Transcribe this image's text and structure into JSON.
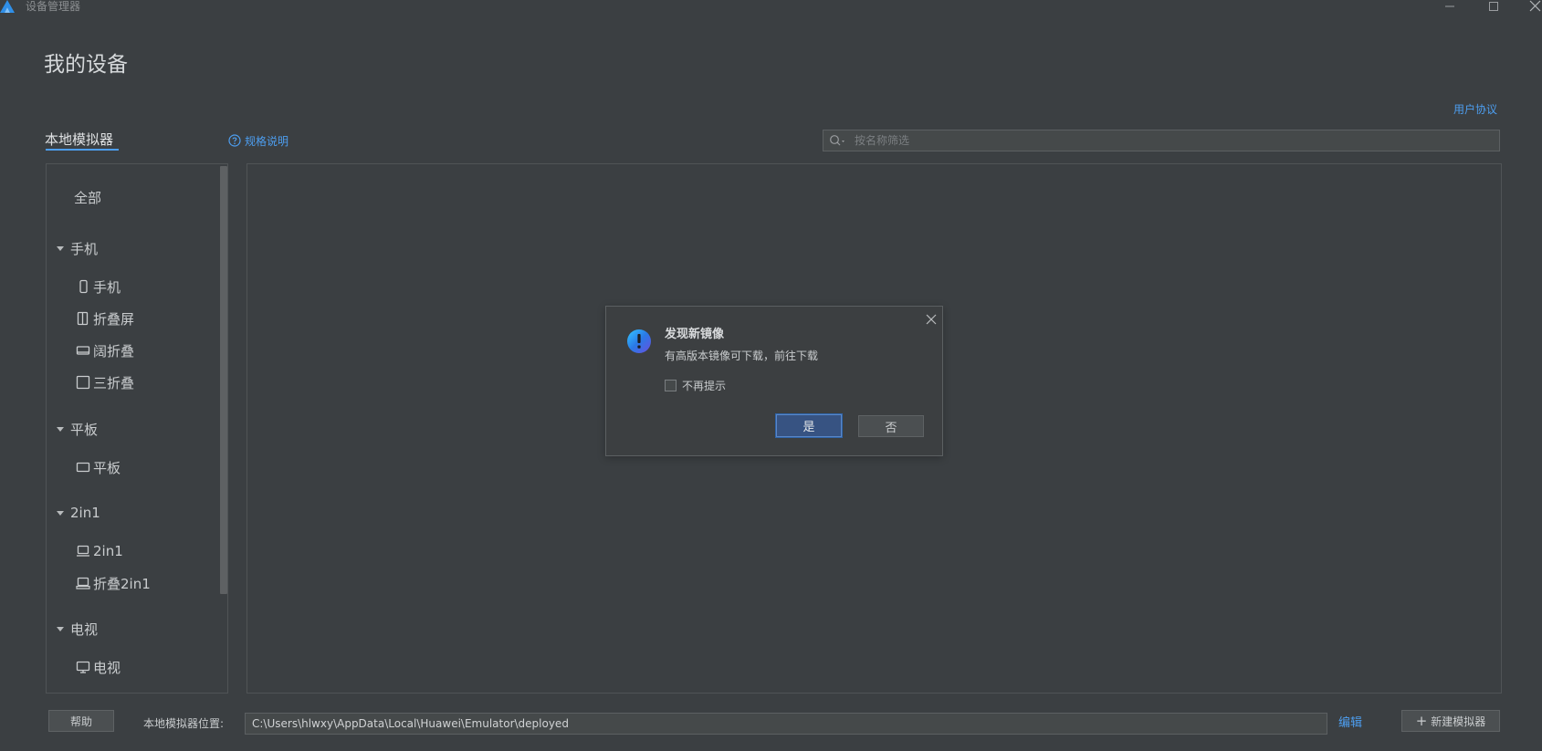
{
  "window": {
    "title": "设备管理器",
    "logo_icon": "harmony-logo-icon",
    "controls": [
      "minimize-icon",
      "maximize-icon",
      "close-icon"
    ]
  },
  "page": {
    "title": "我的设备",
    "agreement_link": "用户协议"
  },
  "tabs": {
    "local_emulator": "本地模拟器",
    "spec_link": "规格说明"
  },
  "search": {
    "placeholder": "按名称筛选",
    "icon": "search-icon"
  },
  "sidebar": {
    "all": "全部",
    "groups": [
      {
        "label": "手机",
        "items": [
          {
            "label": "手机",
            "icon": "phone-icon"
          },
          {
            "label": "折叠屏",
            "icon": "foldable-icon"
          },
          {
            "label": "阔折叠",
            "icon": "wide-fold-icon"
          },
          {
            "label": "三折叠",
            "icon": "tri-fold-icon"
          }
        ]
      },
      {
        "label": "平板",
        "items": [
          {
            "label": "平板",
            "icon": "tablet-icon"
          }
        ]
      },
      {
        "label": "2in1",
        "items": [
          {
            "label": "2in1",
            "icon": "laptop-icon"
          },
          {
            "label": "折叠2in1",
            "icon": "fold-laptop-icon"
          }
        ]
      },
      {
        "label": "电视",
        "items": [
          {
            "label": "电视",
            "icon": "tv-icon"
          }
        ]
      }
    ]
  },
  "bottom": {
    "help_button": "帮助",
    "location_label": "本地模拟器位置:",
    "location_value": "C:\\Users\\hlwxy\\AppData\\Local\\Huawei\\Emulator\\deployed",
    "edit_link": "编辑",
    "new_emulator_button": "新建模拟器"
  },
  "dialog": {
    "title": "发现新镜像",
    "message": "有高版本镜像可下载，前往下载",
    "checkbox_label": "不再提示",
    "yes_button": "是",
    "no_button": "否",
    "icon": "info-icon"
  },
  "colors": {
    "background": "#3b3f42",
    "accent": "#4d9ef0",
    "primary_button": "#375382"
  }
}
